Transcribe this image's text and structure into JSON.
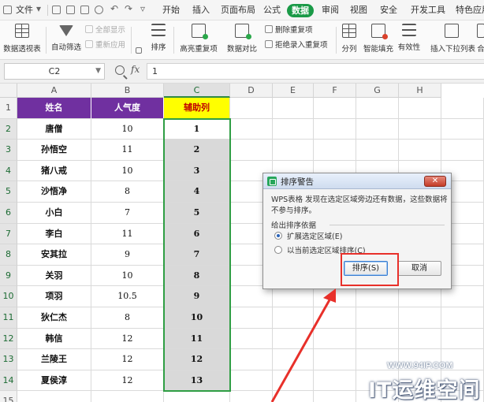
{
  "menubar": {
    "file_label": "文件",
    "tabs": [
      "开始",
      "插入",
      "页面布局",
      "公式",
      "数据",
      "审阅",
      "视图",
      "安全",
      "开发工具",
      "特色应用"
    ],
    "active_tab": "数据",
    "more_arrow": "▿"
  },
  "ribbon": {
    "pivot_label": "数据透视表",
    "autofilter_label": "自动筛选",
    "show_all_label": "全部显示",
    "reapply_label": "重新应用",
    "sort_label": "排序",
    "highlight_dup_label": "高亮重复项",
    "compare_label": "数据对比",
    "remove_dup_label": "删除重复项",
    "reject_dup_label": "拒绝录入重复项",
    "split_label": "分列",
    "flash_fill_label": "智能填充",
    "validity_label": "有效性",
    "insert_dropdown_label": "插入下拉列表",
    "more_label": "合"
  },
  "formula_bar": {
    "cell_ref": "C2",
    "fx": "fx",
    "value": "1"
  },
  "sheet": {
    "columns": [
      "A",
      "B",
      "C",
      "D",
      "E",
      "F",
      "G",
      "H"
    ],
    "selected_column": "C",
    "row_numbers": [
      "1",
      "2",
      "3",
      "4",
      "5",
      "6",
      "7",
      "8",
      "9",
      "10",
      "11",
      "12",
      "13",
      "14",
      "15"
    ],
    "headers": {
      "name": "姓名",
      "popularity": "人气度",
      "helper": "辅助列"
    },
    "rows": [
      {
        "name": "唐僧",
        "popularity": "10",
        "helper": "1"
      },
      {
        "name": "孙悟空",
        "popularity": "11",
        "helper": "2"
      },
      {
        "name": "猪八戒",
        "popularity": "10",
        "helper": "3"
      },
      {
        "name": "沙悟净",
        "popularity": "8",
        "helper": "4"
      },
      {
        "name": "小白",
        "popularity": "7",
        "helper": "5"
      },
      {
        "name": "李白",
        "popularity": "11",
        "helper": "6"
      },
      {
        "name": "安其拉",
        "popularity": "9",
        "helper": "7"
      },
      {
        "name": "关羽",
        "popularity": "10",
        "helper": "8"
      },
      {
        "name": "项羽",
        "popularity": "10.5",
        "helper": "9"
      },
      {
        "name": "狄仁杰",
        "popularity": "8",
        "helper": "10"
      },
      {
        "name": "韩信",
        "popularity": "12",
        "helper": "11"
      },
      {
        "name": "兰陵王",
        "popularity": "12",
        "helper": "12"
      },
      {
        "name": "夏侯淳",
        "popularity": "12",
        "helper": "13"
      }
    ]
  },
  "dialog": {
    "title": "排序警告",
    "close": "✕",
    "message": "WPS表格 发现在选定区域旁边还有数据，这些数据将不参与排序。",
    "group_label": "给出排序依据",
    "option_expand": "扩展选定区域(E)",
    "option_current": "以当前选定区域排序(C)",
    "selected_option": "expand",
    "sort_button": "排序(S)",
    "cancel_button": "取消"
  },
  "watermark": {
    "url": "WWW.94IP.COM",
    "brand": "IT运维空间"
  },
  "colors": {
    "header_purple": "#7030a0",
    "header_yellow": "#ffff00",
    "helper_text_red": "#c00000",
    "selection_green": "#2f9e44",
    "active_tab_green": "#1a9a47",
    "annotation_red": "#e8302a"
  }
}
